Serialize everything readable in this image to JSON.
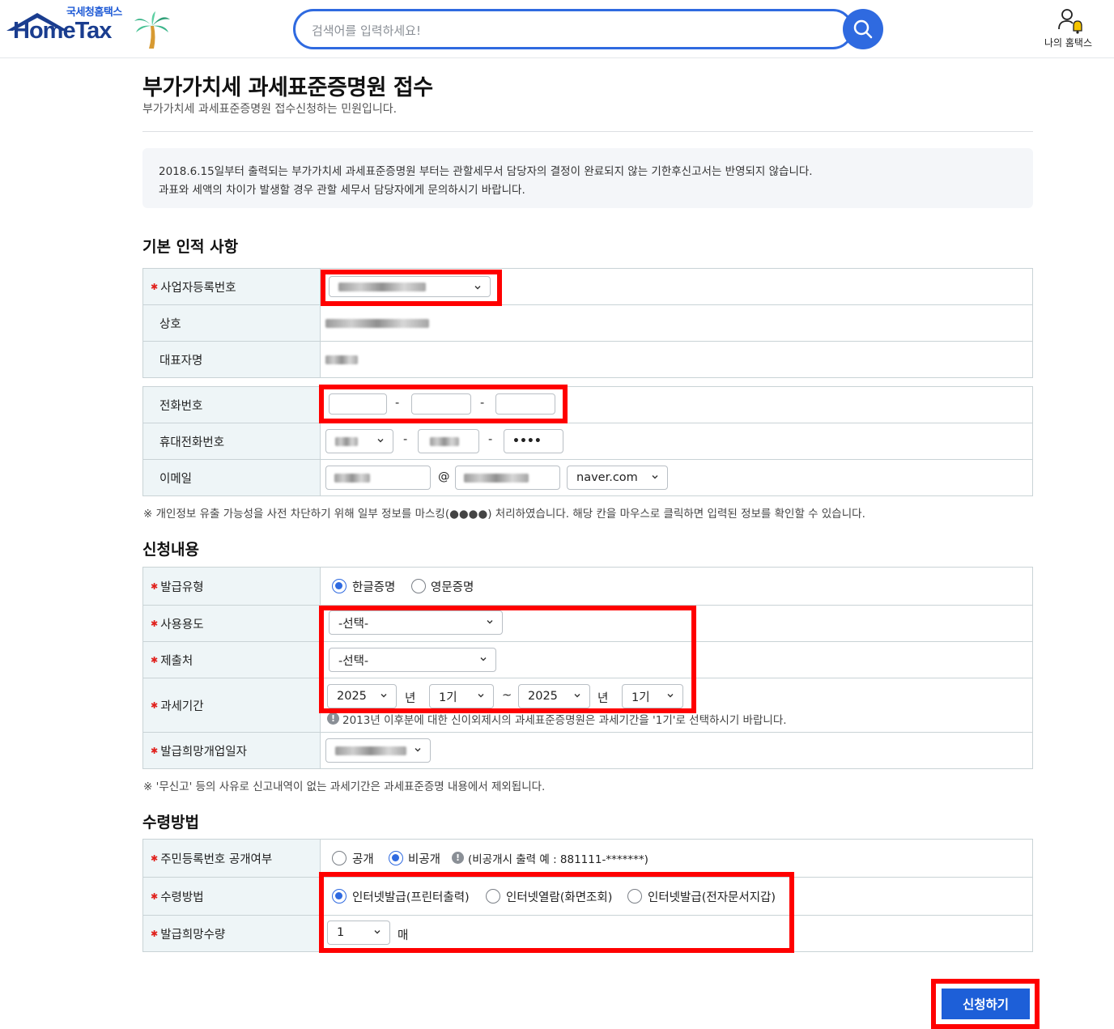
{
  "header": {
    "logo_kr": "국세청홈택스",
    "logo_en": "HomeTax",
    "search_placeholder": "검색어를 입력하세요!",
    "my_hometax": "나의 홈택스"
  },
  "page": {
    "title": "부가가치세 과세표준증명원 접수",
    "subtitle": "부가가치세 과세표준증명원 접수신청하는 민원입니다."
  },
  "notice": {
    "line1": "2018.6.15일부터 출력되는 부가가치세 과세표준증명원 부터는 관할세무서 담당자의 결정이 완료되지 않는 기한후신고서는 반영되지 않습니다.",
    "line2": "과표와 세액의 차이가 발생할 경우 관할 세무서 담당자에게 문의하시기 바랍니다."
  },
  "basic": {
    "title": "기본 인적 사항",
    "biz_no_label": "사업자등록번호",
    "company_label": "상호",
    "ceo_label": "대표자명",
    "phone_label": "전화번호",
    "phone_sep": "-",
    "mobile_label": "휴대전화번호",
    "mobile_sep": "-",
    "mobile_masked": "••••",
    "email_label": "이메일",
    "email_at": "@",
    "email_domain": "naver.com",
    "privacy_note": "※ 개인정보 유출 가능성을 사전 차단하기 위해 일부 정보를 마스킹(●●●●) 처리하였습니다. 해당 칸을 마우스로 클릭하면 입력된 정보를 확인할 수 있습니다."
  },
  "apply": {
    "title": "신청내용",
    "issue_type_label": "발급유형",
    "issue_type_options": [
      "한글증명",
      "영문증명"
    ],
    "purpose_label": "사용용도",
    "purpose_value": "-선택-",
    "submit_to_label": "제출처",
    "submit_to_value": "-선택-",
    "period_label": "과세기간",
    "period_from_year": "2025",
    "period_from_term": "1기",
    "period_to_year": "2025",
    "period_to_term": "1기",
    "year_unit": "년",
    "tilde": "~",
    "period_hint": "2013년 이후분에 대한 신이외제시의 과세표준증명원은 과세기간을 '1기'로 선택하시기 바랍니다.",
    "open_date_label": "발급희망개업일자",
    "footnote": "※ '무신고' 등의 사유로 신고내역이 없는 과세기간은 과세표준증명 내용에서 제외됩니다."
  },
  "receive": {
    "title": "수령방법",
    "rrn_label": "주민등록번호 공개여부",
    "rrn_options": [
      "공개",
      "비공개"
    ],
    "rrn_example": "(비공개시 출력 예 : 881111-*******)",
    "method_label": "수령방법",
    "method_options": [
      "인터넷발급(프린터출력)",
      "인터넷열람(화면조회)",
      "인터넷발급(전자문서지갑)"
    ],
    "qty_label": "발급희망수량",
    "qty_value": "1",
    "qty_unit": "매"
  },
  "submit_label": "신청하기",
  "colors": {
    "primary": "#2f6ae0",
    "highlight": "#ff0000",
    "header_cell": "#eef5f7"
  }
}
